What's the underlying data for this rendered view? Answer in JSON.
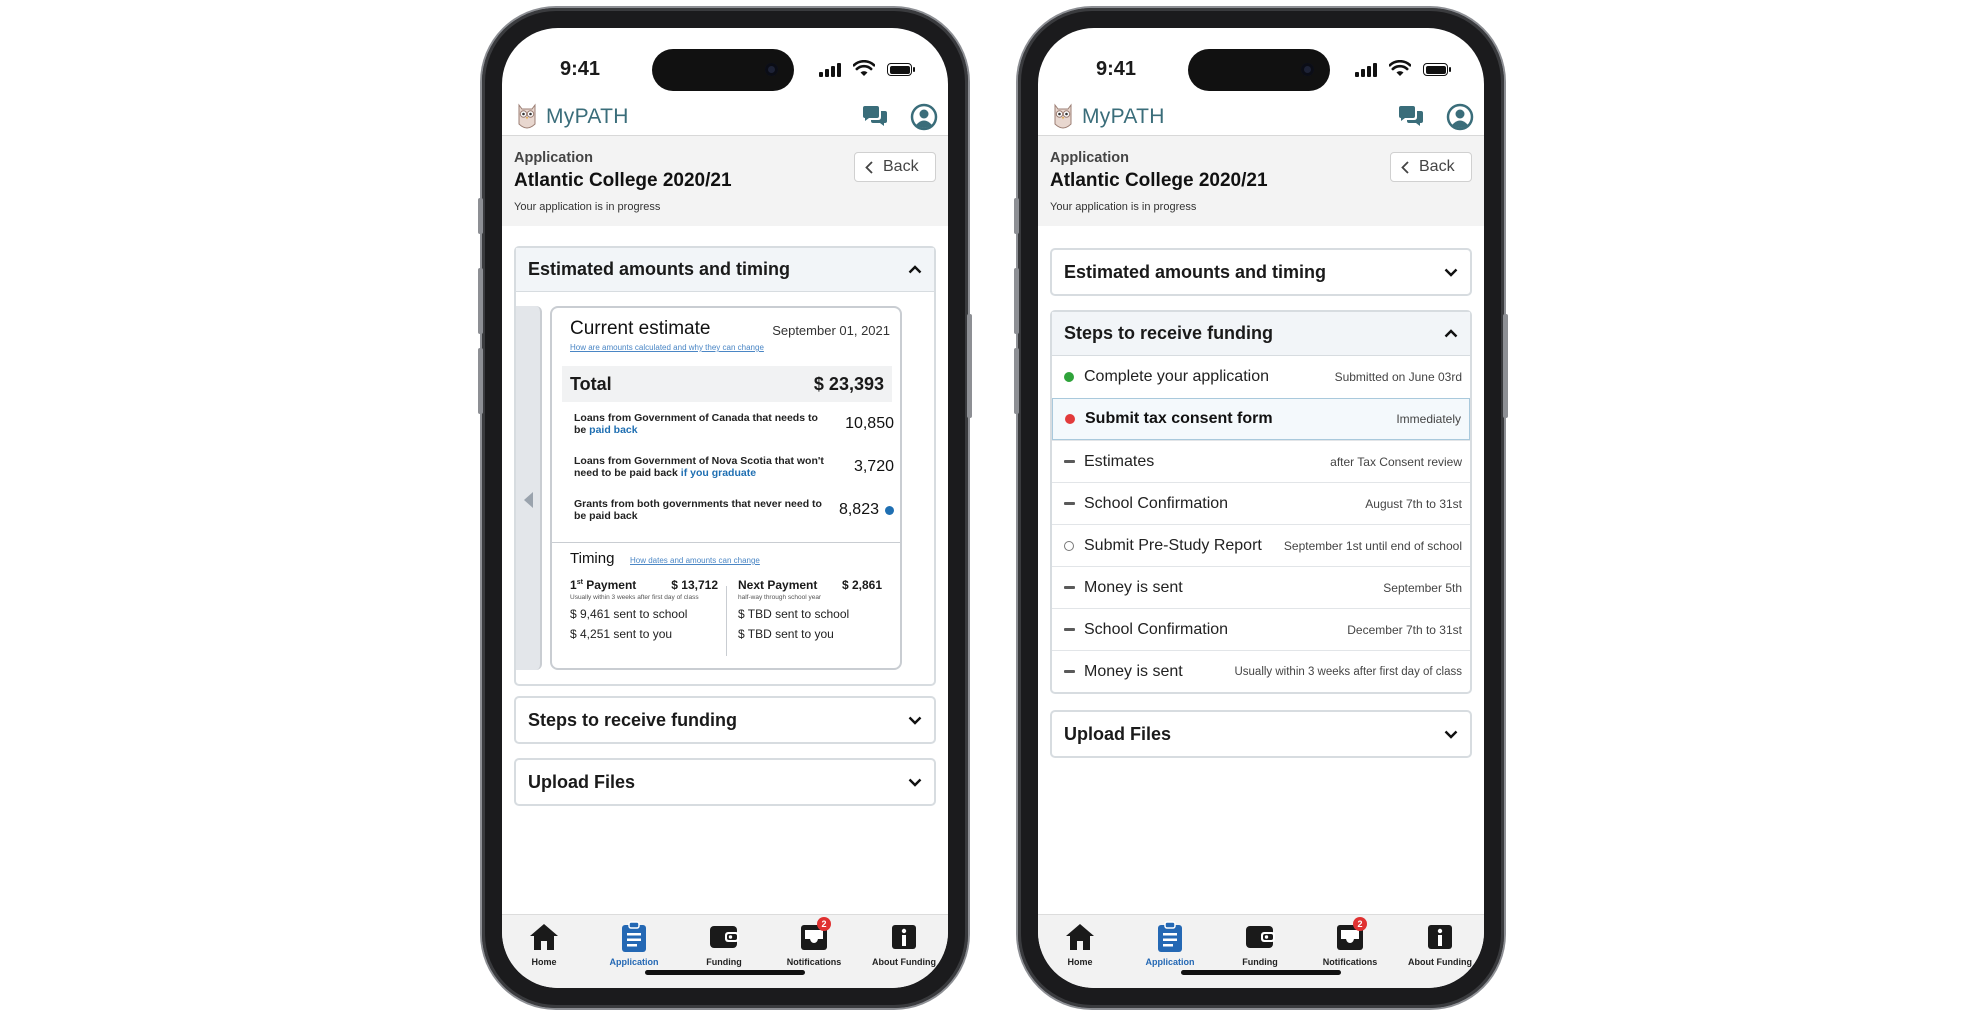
{
  "colors": {
    "brand": "#3a6d7a",
    "accent": "#2468b4",
    "status_done": "#2fa33a",
    "status_action": "#e23b3b"
  },
  "status_bar": {
    "time": "9:41"
  },
  "app": {
    "name": "MyPATH"
  },
  "header": {
    "kicker": "Application",
    "title": "Atlantic College 2020/21",
    "subtitle": "Your application is in progress",
    "back_label": "Back"
  },
  "sections": {
    "estimates": "Estimated amounts and timing",
    "steps": "Steps to receive funding",
    "upload": "Upload Files"
  },
  "estimate": {
    "title": "Current estimate",
    "date": "September 01, 2021",
    "link": "How are amounts calculated and why they can change",
    "total_label": "Total",
    "total_value": "$ 23,393",
    "items": [
      {
        "text_a": "Loans from Government of Canada that needs to be ",
        "highlight": "paid back",
        "value": "10,850"
      },
      {
        "text_a": "Loans from Government of Nova Scotia that won't need to be paid back ",
        "highlight": "if you graduate",
        "value": "3,720"
      },
      {
        "text_a": "Grants from both governments that never need to be paid back",
        "highlight": "",
        "value": "8,823"
      }
    ],
    "timing_title": "Timing",
    "timing_link": "How dates and amounts can change",
    "payments": [
      {
        "label_num": "1",
        "label_sup": "st",
        "label_rest": " Payment",
        "amount": "$ 13,712",
        "note": "Usually within 3 weeks after first day of class",
        "school": "$ 9,461 sent to school",
        "you": "$ 4,251 sent to you"
      },
      {
        "label_num": "",
        "label_sup": "",
        "label_rest": "Next Payment",
        "amount": "$ 2,861",
        "note": "half-way through school year",
        "school": "$ TBD sent to school",
        "you": "$ TBD sent to you"
      }
    ]
  },
  "steps": [
    {
      "status": "done",
      "label": "Complete your application",
      "when": "Submitted on June 03rd"
    },
    {
      "status": "action",
      "label": "Submit tax consent form",
      "when": "Immediately"
    },
    {
      "status": "pending",
      "label": "Estimates",
      "when": "after Tax Consent review"
    },
    {
      "status": "pending",
      "label": "School Confirmation",
      "when": "August 7th to 31st"
    },
    {
      "status": "upcoming",
      "label": "Submit Pre-Study Report",
      "when": "September 1st until end of school"
    },
    {
      "status": "pending",
      "label": "Money is sent",
      "when": "September 5th"
    },
    {
      "status": "pending",
      "label": "School Confirmation",
      "when": "December 7th to 31st"
    },
    {
      "status": "pending",
      "label": "Money is sent",
      "when": "Usually within 3 weeks after first day of class"
    }
  ],
  "tabs": [
    {
      "label": "Home",
      "icon": "home-icon"
    },
    {
      "label": "Application",
      "icon": "clipboard-icon"
    },
    {
      "label": "Funding",
      "icon": "wallet-icon"
    },
    {
      "label": "Notifications",
      "icon": "inbox-icon",
      "badge": "2"
    },
    {
      "label": "About Funding",
      "icon": "info-icon"
    }
  ]
}
